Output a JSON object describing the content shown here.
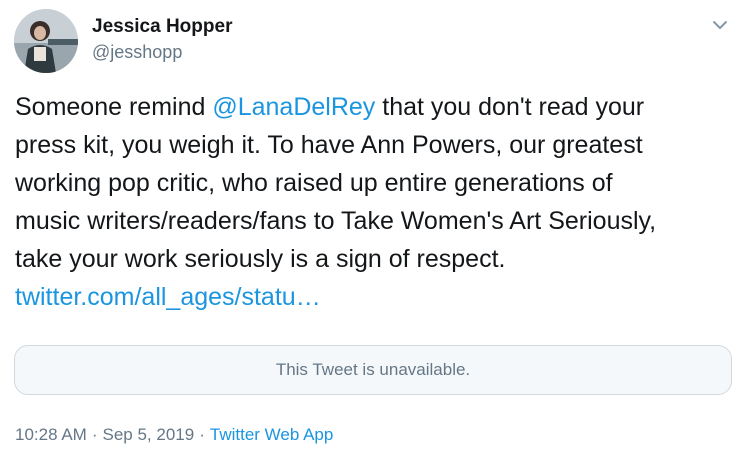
{
  "author": {
    "name": "Jessica Hopper",
    "handle": "@jesshopp",
    "avatar_icon": "profile-photo"
  },
  "menu": {
    "icon": "chevron-down-icon"
  },
  "tweet": {
    "line1_pre": "Someone remind ",
    "mention": "@LanaDelRey",
    "line1_post": " that you don't read your",
    "line2": "press kit, you weigh it. To have Ann Powers, our greatest",
    "line3": "working pop critic, who raised up entire generations of",
    "line4": "music writers/readers/fans to Take Women's Art Seriously,",
    "line5": "take your work seriously is a sign of respect.",
    "link": "twitter.com/all_ages/statu…"
  },
  "quoted": {
    "text": "This Tweet is unavailable."
  },
  "meta": {
    "time": "10:28 AM",
    "separator": "·",
    "date": "Sep 5, 2019",
    "source": "Twitter Web App"
  },
  "colors": {
    "link": "#1b95e0",
    "secondary_text": "#657786",
    "primary_text": "#14171a",
    "card_bg": "#f5f8fa",
    "card_border": "#cfd9de"
  }
}
